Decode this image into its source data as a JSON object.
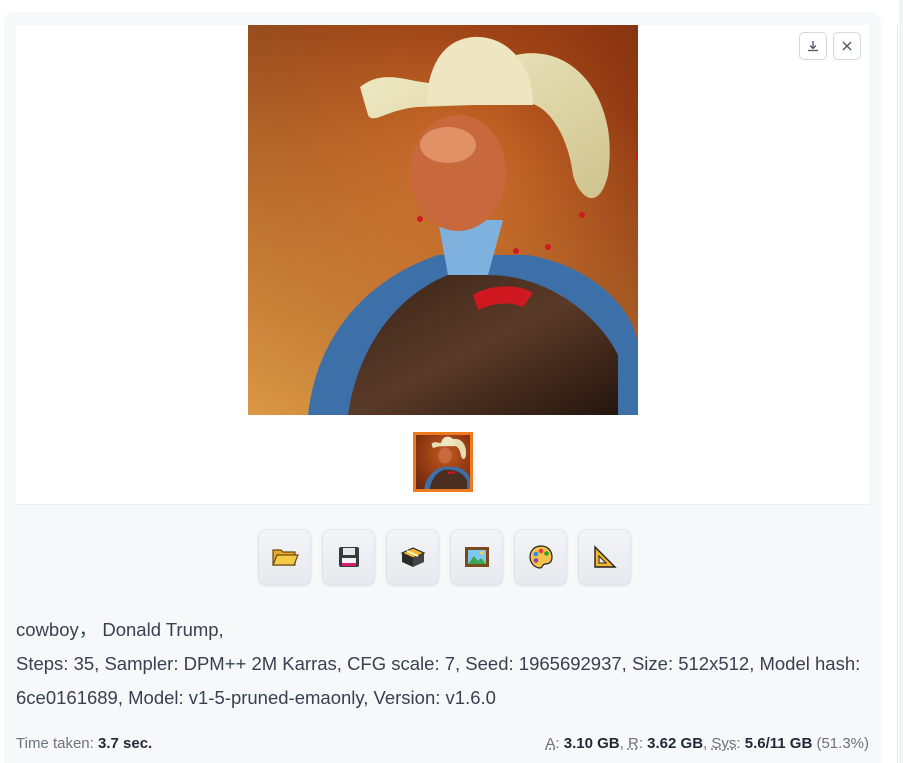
{
  "gallery": {
    "download_label": "download-icon",
    "close_label": "close-icon",
    "image_subject": "cowboy, Donald Trump"
  },
  "toolbar": {
    "buttons": [
      {
        "name": "open-folder-button",
        "icon": "folder-icon"
      },
      {
        "name": "save-button",
        "icon": "floppy-disk-icon"
      },
      {
        "name": "zip-button",
        "icon": "package-icon"
      },
      {
        "name": "send-to-img2img-button",
        "icon": "framed-picture-icon"
      },
      {
        "name": "send-to-inpaint-button",
        "icon": "palette-icon"
      },
      {
        "name": "send-to-extras-button",
        "icon": "triangular-ruler-icon"
      }
    ]
  },
  "info": {
    "prompt": "cowboy，  Donald Trump,",
    "params": "Steps: 35, Sampler: DPM++ 2M Karras, CFG scale: 7, Seed: 1965692937, Size: 512x512, Model hash: 6ce0161689, Model: v1-5-pruned-emaonly, Version: v1.6.0"
  },
  "footer": {
    "time_label": "Time taken:",
    "time_value": "3.7 sec.",
    "a_label": "A",
    "a_value": "3.10 GB",
    "r_label": "R",
    "r_value": "3.62 GB",
    "sys_label": "Sys",
    "sys_value": "5.6/11 GB",
    "sys_pct": "(51.3%)"
  },
  "colors": {
    "accent": "#f07a1e",
    "panel_bg": "#f7f8fa"
  }
}
